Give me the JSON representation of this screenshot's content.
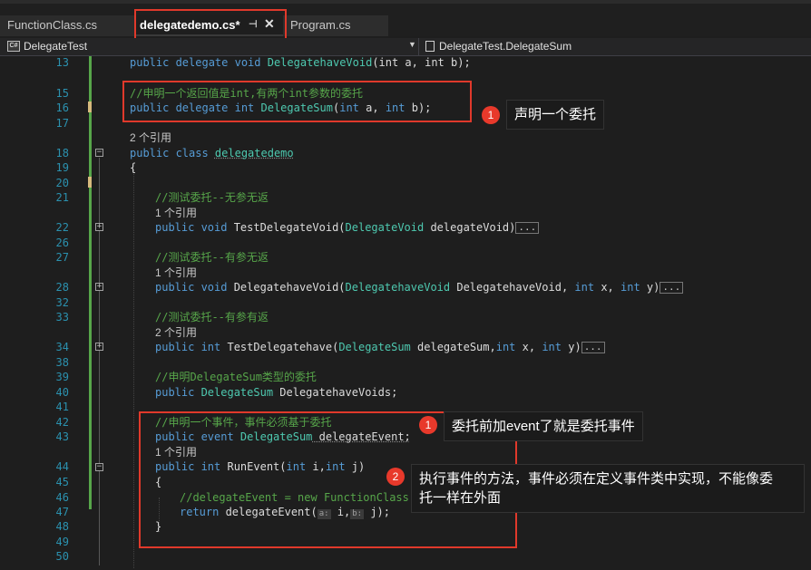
{
  "tabs": [
    {
      "label": "FunctionClass.cs"
    },
    {
      "label": "delegatedemo.cs*",
      "pin": "⊣",
      "close": "✕"
    },
    {
      "label": "Program.cs"
    }
  ],
  "nav": {
    "badge": "C#",
    "left": "DelegateTest",
    "right": "DelegateTest.DelegateSum",
    "dropdown": "▼"
  },
  "lines": {
    "l13": "13",
    "l15": "15",
    "l16": "16",
    "l17": "17",
    "l18": "18",
    "l19": "19",
    "l20": "20",
    "l21": "21",
    "l22": "22",
    "l26": "26",
    "l27": "27",
    "l28": "28",
    "l32": "32",
    "l33": "33",
    "l34": "34",
    "l38": "38",
    "l39": "39",
    "l40": "40",
    "l41": "41",
    "l42": "42",
    "l43": "43",
    "l44": "44",
    "l45": "45",
    "l46": "46",
    "l47": "47",
    "l48": "48",
    "l49": "49",
    "l50": "50"
  },
  "code": {
    "c13_kw": "public delegate void ",
    "c13_ty": "DelegatehaveVoid",
    "c13_rest": "(int a, int b);",
    "c15": "//申明一个返回值是int,有两个int参数的委托",
    "c16_kw": "public delegate int ",
    "c16_ty": "DelegateSum",
    "c16_p1": "(",
    "c16_kw2": "int",
    "c16_p2": " a, ",
    "c16_kw3": "int",
    "c16_p3": " b);",
    "refs_class": "2 个引用",
    "c18_kw": "public class ",
    "c18_ty": "delegatedemo",
    "c19": "{",
    "c21": "//测试委托--无参无返",
    "refs22": "1 个引用",
    "c22_kw": "public void ",
    "c22_name": "TestDelegateVoid(",
    "c22_ty": "DelegateVoid",
    "c22_rest": " delegateVoid)",
    "c27": "//测试委托--有参无返",
    "refs28": "1 个引用",
    "c28_kw": "public void ",
    "c28_name": "DelegatehaveVoid(",
    "c28_ty": "DelegatehaveVoid",
    "c28_rest": " DelegatehaveVoid, ",
    "c28_kw2": "int",
    "c28_x": " x, ",
    "c28_kw3": "int",
    "c28_y": " y)",
    "c33": "//测试委托--有参有返",
    "refs34": "2 个引用",
    "c34_kw": "public int ",
    "c34_name": "TestDelegatehave(",
    "c34_ty": "DelegateSum",
    "c34_rest": " delegateSum,",
    "c34_kw2": "int",
    "c34_x": " x, ",
    "c34_kw3": "int",
    "c34_y": " y)",
    "collapsed": "...",
    "c39": "//申明DelegateSum类型的委托",
    "c40_kw": "public ",
    "c40_ty": "DelegateSum",
    "c40_rest": " DelegatehaveVoids;",
    "c42": "//申明一个事件，事件必须基于委托",
    "c43_kw": "public event ",
    "c43_ty": "DelegateSum",
    "c43_rest": " delegateEvent;",
    "refs44": "1 个引用",
    "c44_kw": "public int ",
    "c44_name": "RunEvent(",
    "c44_kw2": "int",
    "c44_i": " i,",
    "c44_kw3": "int",
    "c44_j": " j)",
    "c45": "{",
    "c46": "//delegateEvent = new FunctionClass().",
    "c47_kw": "return ",
    "c47_name": "delegateEvent(",
    "c47_hint_a": "a:",
    "c47_i": " i,",
    "c47_hint_b": "b:",
    "c47_j": " j);",
    "c48": "}"
  },
  "annotations": {
    "a1_num": "1",
    "a1_text": "声明一个委托",
    "a2_num": "1",
    "a2_text": "委托前加event了就是委托事件",
    "a3_num": "2",
    "a3_text_line1": "执行事件的方法，事件必须在定义事件类中实现，不能像委",
    "a3_text_line2": "托一样在外面"
  },
  "colors": {
    "keyword": "#569cd6",
    "type": "#4ec9b0",
    "comment": "#57a64a",
    "line_number": "#2b91af",
    "annotation_red": "#e0392b"
  }
}
